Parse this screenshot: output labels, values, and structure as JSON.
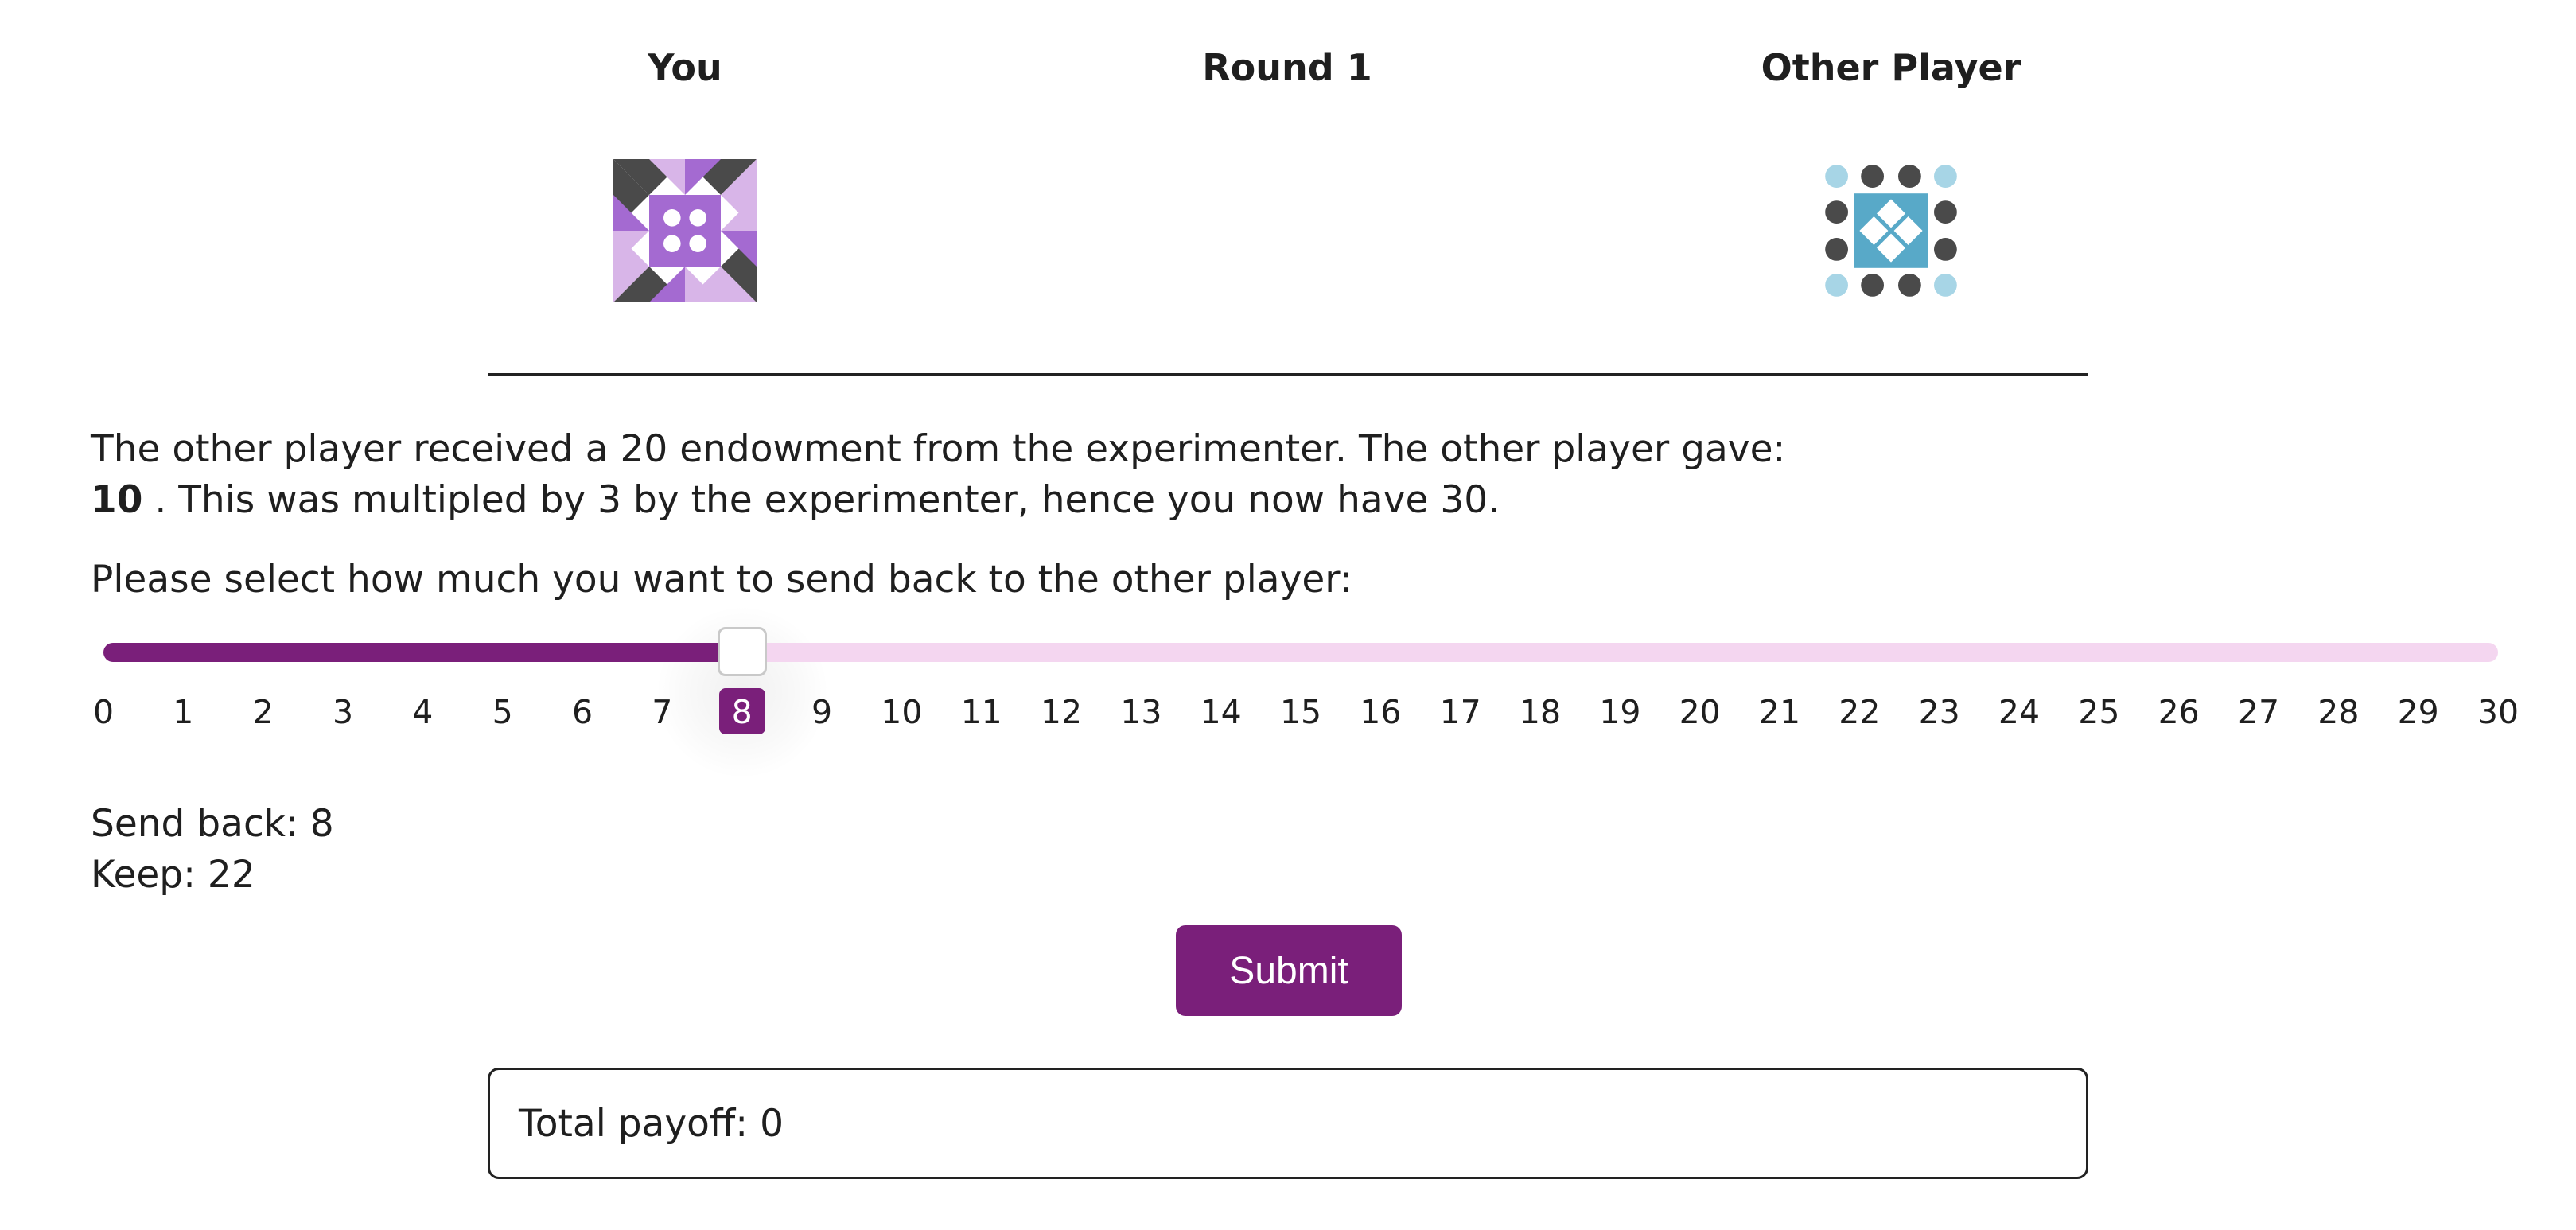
{
  "header": {
    "you_label": "You",
    "round_label": "Round 1",
    "other_label": "Other Player"
  },
  "info": {
    "line1": "The other player received a 20 endowment from the experimenter. The other player gave:",
    "given_amount": "10",
    "line2_rest": " . This was multipled by 3 by the experimenter, hence you now have 30."
  },
  "prompt": "Please select how much you want to send back to the other player:",
  "slider": {
    "min": 0,
    "max": 30,
    "value": 8,
    "ticks": [
      "0",
      "1",
      "2",
      "3",
      "4",
      "5",
      "6",
      "7",
      "8",
      "9",
      "10",
      "11",
      "12",
      "13",
      "14",
      "15",
      "16",
      "17",
      "18",
      "19",
      "20",
      "21",
      "22",
      "23",
      "24",
      "25",
      "26",
      "27",
      "28",
      "29",
      "30"
    ]
  },
  "results": {
    "send_back": "Send back: 8",
    "keep": "Keep: 22"
  },
  "submit_label": "Submit",
  "payoff": "Total payoff: 0",
  "colors": {
    "accent": "#7a1f7a",
    "track_light": "#f4d6f0",
    "you_avatar_primary": "#a46ad1",
    "you_avatar_light": "#d8b5e8",
    "other_avatar_primary": "#58a9c8",
    "other_avatar_light": "#a7d5e6",
    "dark": "#4a4a4a"
  },
  "icons": {
    "you_avatar": "purple-quilt-avatar",
    "other_avatar": "blue-dots-avatar"
  }
}
